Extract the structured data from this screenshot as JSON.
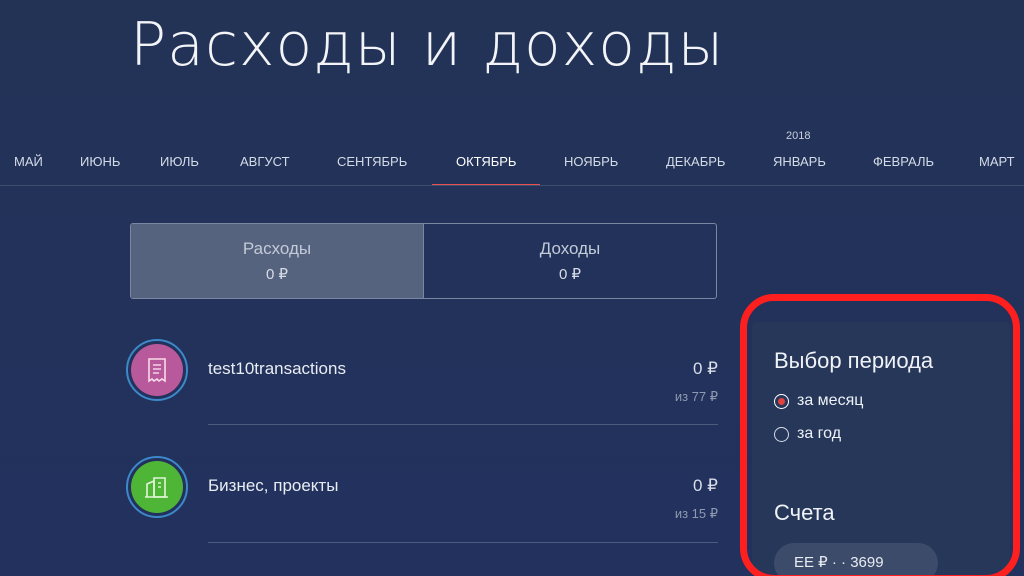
{
  "page": {
    "title": "Расходы и доходы"
  },
  "months": {
    "year_label": "2018",
    "items": [
      "МАЙ",
      "ИЮНЬ",
      "ИЮЛЬ",
      "АВГУСТ",
      "СЕНТЯБРЬ",
      "ОКТЯБРЬ",
      "НОЯБРЬ",
      "ДЕКАБРЬ",
      "ЯНВАРЬ",
      "ФЕВРАЛЬ",
      "МАРТ"
    ],
    "active": "ОКТЯБРЬ"
  },
  "toggle": {
    "expenses": {
      "label": "Расходы",
      "value": "0 ₽"
    },
    "income": {
      "label": "Доходы",
      "value": "0 ₽"
    },
    "selected": "expenses"
  },
  "categories": [
    {
      "name": "test10transactions",
      "amount": "0 ₽",
      "limit": "из 77 ₽",
      "icon": "receipt-icon",
      "color": "#b8599c"
    },
    {
      "name": "Бизнес, проекты",
      "amount": "0 ₽",
      "limit": "из 15 ₽",
      "icon": "building-icon",
      "color": "#4fb536"
    }
  ],
  "period": {
    "title": "Выбор периода",
    "options": [
      {
        "label": "за месяц",
        "checked": true
      },
      {
        "label": "за год",
        "checked": false
      }
    ]
  },
  "accounts": {
    "title": "Счета",
    "chip_label": "ЕЕ ₽ · · 3699"
  },
  "colors": {
    "accent": "#e8514c",
    "highlight": "#ff1f1f",
    "background": "#22325a"
  }
}
